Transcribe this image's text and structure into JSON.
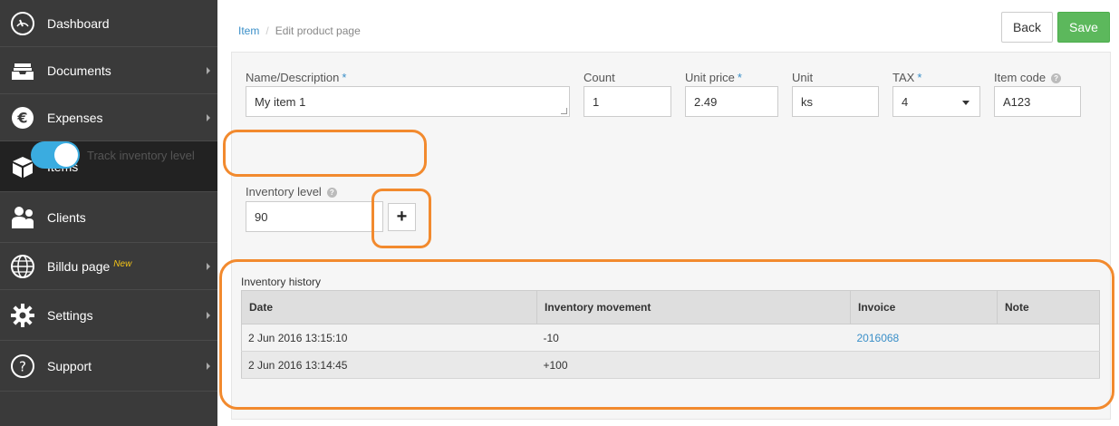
{
  "sidebar": {
    "items": [
      {
        "label": "Dashboard",
        "icon": "dashboard-gauge-icon",
        "arrow": false
      },
      {
        "label": "Documents",
        "icon": "documents-tray-icon",
        "arrow": true
      },
      {
        "label": "Expenses",
        "icon": "euro-icon",
        "arrow": true
      },
      {
        "label": "Items",
        "icon": "box-icon",
        "arrow": false,
        "active": true
      },
      {
        "label": "Clients",
        "icon": "clients-icon",
        "arrow": false
      },
      {
        "label": "Billdu page",
        "badge": "New",
        "icon": "globe-icon",
        "arrow": true
      },
      {
        "label": "Settings",
        "icon": "gear-icon",
        "arrow": true
      },
      {
        "label": "Support",
        "icon": "question-icon",
        "arrow": true
      }
    ]
  },
  "breadcrumb": {
    "parent": "Item",
    "current": "Edit product page"
  },
  "toolbar": {
    "back_label": "Back",
    "save_label": "Save"
  },
  "form": {
    "name": {
      "label": "Name/Description",
      "required": "*",
      "value": "My item 1"
    },
    "count": {
      "label": "Count",
      "value": "1"
    },
    "unit_price": {
      "label": "Unit price",
      "required": "*",
      "value": "2.49"
    },
    "unit": {
      "label": "Unit",
      "value": "ks"
    },
    "tax": {
      "label": "TAX",
      "required": "*",
      "value": "4"
    },
    "item_code": {
      "label": "Item code",
      "value": "A123",
      "help": "?"
    },
    "track_inventory": {
      "label": "Track inventory level",
      "on": true
    },
    "inventory_level": {
      "label": "Inventory level",
      "value": "90",
      "help": "?"
    },
    "add_label": "+"
  },
  "history": {
    "title": "Inventory history",
    "columns": [
      "Date",
      "Inventory movement",
      "Invoice",
      "Note"
    ],
    "rows": [
      {
        "date": "2 Jun 2016 13:15:10",
        "movement": "-10",
        "invoice": "2016068",
        "note": ""
      },
      {
        "date": "2 Jun 2016 13:14:45",
        "movement": "+100",
        "invoice": "",
        "note": ""
      }
    ]
  },
  "colors": {
    "sidebar_bg": "#3a3a3a",
    "accent_blue": "#3a8fc8",
    "toggle_on": "#3aace0",
    "save_green": "#5cb85c",
    "highlight_orange": "#f28a2e"
  }
}
